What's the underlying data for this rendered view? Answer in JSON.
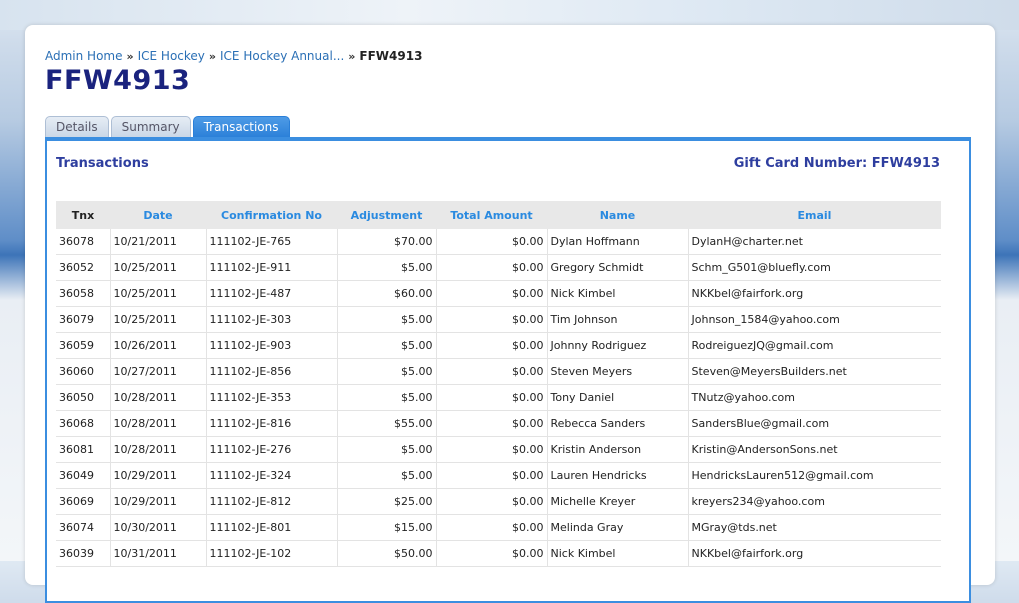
{
  "breadcrumb": {
    "items": [
      "Admin Home",
      "ICE Hockey",
      "ICE Hockey Annual..."
    ],
    "separator": "»",
    "current": "FFW4913"
  },
  "page": {
    "title": "FFW4913"
  },
  "tabs": [
    {
      "label": "Details",
      "active": false
    },
    {
      "label": "Summary",
      "active": false
    },
    {
      "label": "Transactions",
      "active": true
    }
  ],
  "section": {
    "title": "Transactions",
    "gift_card_label": "Gift Card Number: FFW4913"
  },
  "table": {
    "headers": [
      "Tnx",
      "Date",
      "Confirmation No",
      "Adjustment",
      "Total Amount",
      "Name",
      "Email"
    ],
    "rows": [
      [
        "36078",
        "10/21/2011",
        "111102-JE-765",
        "$70.00",
        "$0.00",
        "Dylan Hoffmann",
        "DylanH@charter.net"
      ],
      [
        "36052",
        "10/25/2011",
        "111102-JE-911",
        "$5.00",
        "$0.00",
        "Gregory Schmidt",
        "Schm_G501@bluefly.com"
      ],
      [
        "36058",
        "10/25/2011",
        "111102-JE-487",
        "$60.00",
        "$0.00",
        "Nick Kimbel",
        "NKKbel@fairfork.org"
      ],
      [
        "36079",
        "10/25/2011",
        "111102-JE-303",
        "$5.00",
        "$0.00",
        "Tim Johnson",
        "Johnson_1584@yahoo.com"
      ],
      [
        "36059",
        "10/26/2011",
        "111102-JE-903",
        "$5.00",
        "$0.00",
        "Johnny Rodriguez",
        "RodreiguezJQ@gmail.com"
      ],
      [
        "36060",
        "10/27/2011",
        "111102-JE-856",
        "$5.00",
        "$0.00",
        "Steven Meyers",
        "Steven@MeyersBuilders.net"
      ],
      [
        "36050",
        "10/28/2011",
        "111102-JE-353",
        "$5.00",
        "$0.00",
        "Tony Daniel",
        "TNutz@yahoo.com"
      ],
      [
        "36068",
        "10/28/2011",
        "111102-JE-816",
        "$55.00",
        "$0.00",
        "Rebecca Sanders",
        "SandersBlue@gmail.com"
      ],
      [
        "36081",
        "10/28/2011",
        "111102-JE-276",
        "$5.00",
        "$0.00",
        "Kristin Anderson",
        "Kristin@AndersonSons.net"
      ],
      [
        "36049",
        "10/29/2011",
        "111102-JE-324",
        "$5.00",
        "$0.00",
        "Lauren Hendricks",
        "HendricksLauren512@gmail.com"
      ],
      [
        "36069",
        "10/29/2011",
        "111102-JE-812",
        "$25.00",
        "$0.00",
        "Michelle Kreyer",
        "kreyers234@yahoo.com"
      ],
      [
        "36074",
        "10/30/2011",
        "111102-JE-801",
        "$15.00",
        "$0.00",
        "Melinda Gray",
        "MGray@tds.net"
      ],
      [
        "36039",
        "10/31/2011",
        "111102-JE-102",
        "$50.00",
        "$0.00",
        "Nick Kimbel",
        "NKKbel@fairfork.org"
      ]
    ]
  }
}
